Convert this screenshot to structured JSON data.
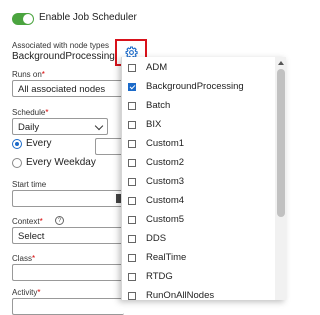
{
  "scheduler": {
    "enable_label": "Enable Job Scheduler",
    "enabled": true
  },
  "node_types": {
    "label": "Associated with node types",
    "value": "BackgroundProcessing",
    "settings_icon": "gear-icon"
  },
  "runs_on": {
    "label": "Runs on",
    "required_marker": "*",
    "value": "All associated nodes"
  },
  "schedule": {
    "label": "Schedule",
    "required_marker": "*",
    "value": "Daily",
    "options": [
      {
        "label": "Every",
        "selected": true
      },
      {
        "label": "Every Weekday",
        "selected": false
      }
    ]
  },
  "start_time": {
    "label": "Start time"
  },
  "context": {
    "label": "Context",
    "required_marker": "*",
    "help_glyph": "?",
    "value": "Select"
  },
  "class_field": {
    "label": "Class",
    "required_marker": "*"
  },
  "activity": {
    "label": "Activity",
    "required_marker": "*"
  },
  "node_type_dropdown": {
    "items": [
      {
        "label": "ADM",
        "checked": false
      },
      {
        "label": "BackgroundProcessing",
        "checked": true
      },
      {
        "label": "Batch",
        "checked": false
      },
      {
        "label": "BIX",
        "checked": false
      },
      {
        "label": "Custom1",
        "checked": false
      },
      {
        "label": "Custom2",
        "checked": false
      },
      {
        "label": "Custom3",
        "checked": false
      },
      {
        "label": "Custom4",
        "checked": false
      },
      {
        "label": "Custom5",
        "checked": false
      },
      {
        "label": "DDS",
        "checked": false
      },
      {
        "label": "RealTime",
        "checked": false
      },
      {
        "label": "RTDG",
        "checked": false
      },
      {
        "label": "RunOnAllNodes",
        "checked": false
      }
    ]
  },
  "colors": {
    "toggle_on": "#4ba43f",
    "accent_blue": "#1b6ac9",
    "highlight_red": "#d8121b",
    "required_red": "#d60000"
  }
}
